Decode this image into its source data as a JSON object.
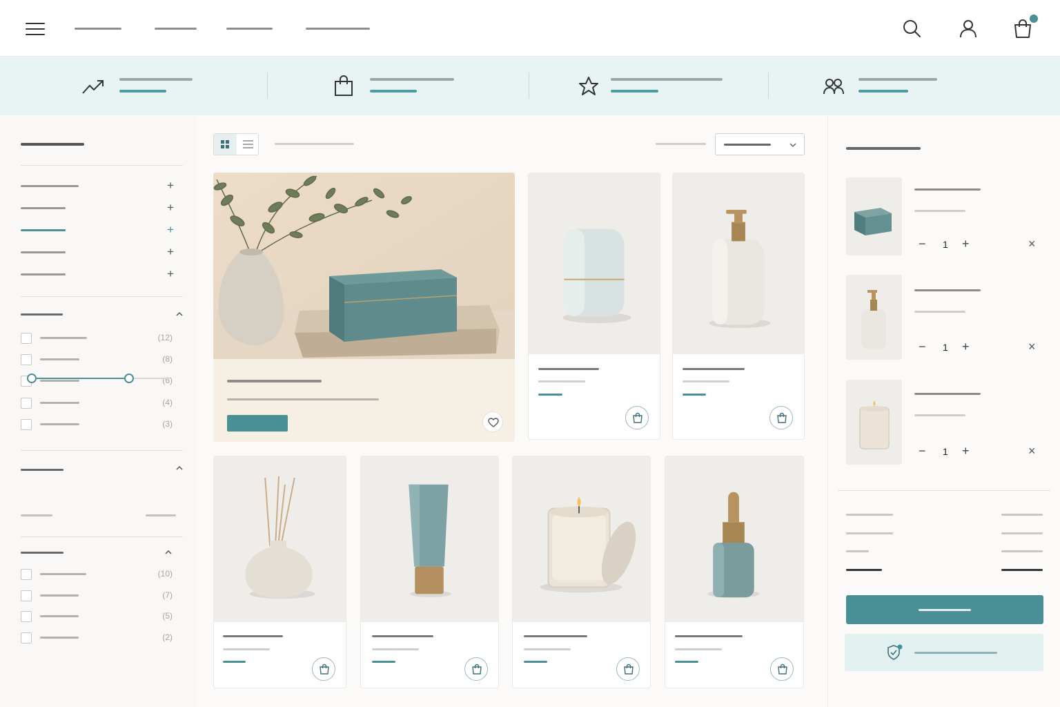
{
  "header": {
    "nav_links": [
      "",
      "",
      "",
      ""
    ]
  },
  "filters": {
    "group1_counts": [
      "(12)",
      "(8)",
      "(6)",
      "(4)",
      "(3)"
    ],
    "group2_counts": [
      "(10)",
      "(7)",
      "(5)",
      "(2)"
    ]
  },
  "cart": {
    "items": [
      {
        "qty": "1"
      },
      {
        "qty": "1"
      },
      {
        "qty": "1"
      }
    ],
    "minus": "−",
    "plus": "+",
    "remove": "×"
  },
  "colors": {
    "accent": "#4a8f96",
    "strip": "#e8f3f3",
    "badge": "#4a8f96"
  },
  "icons": [
    "menu-icon",
    "search-icon",
    "user-icon",
    "cart-icon",
    "trending-up-icon",
    "shopping-bag-icon",
    "star-icon",
    "users-icon",
    "grid-icon",
    "list-icon",
    "chevron-down-icon",
    "chevron-up-icon",
    "heart-icon",
    "close-icon",
    "shield-check-icon"
  ]
}
